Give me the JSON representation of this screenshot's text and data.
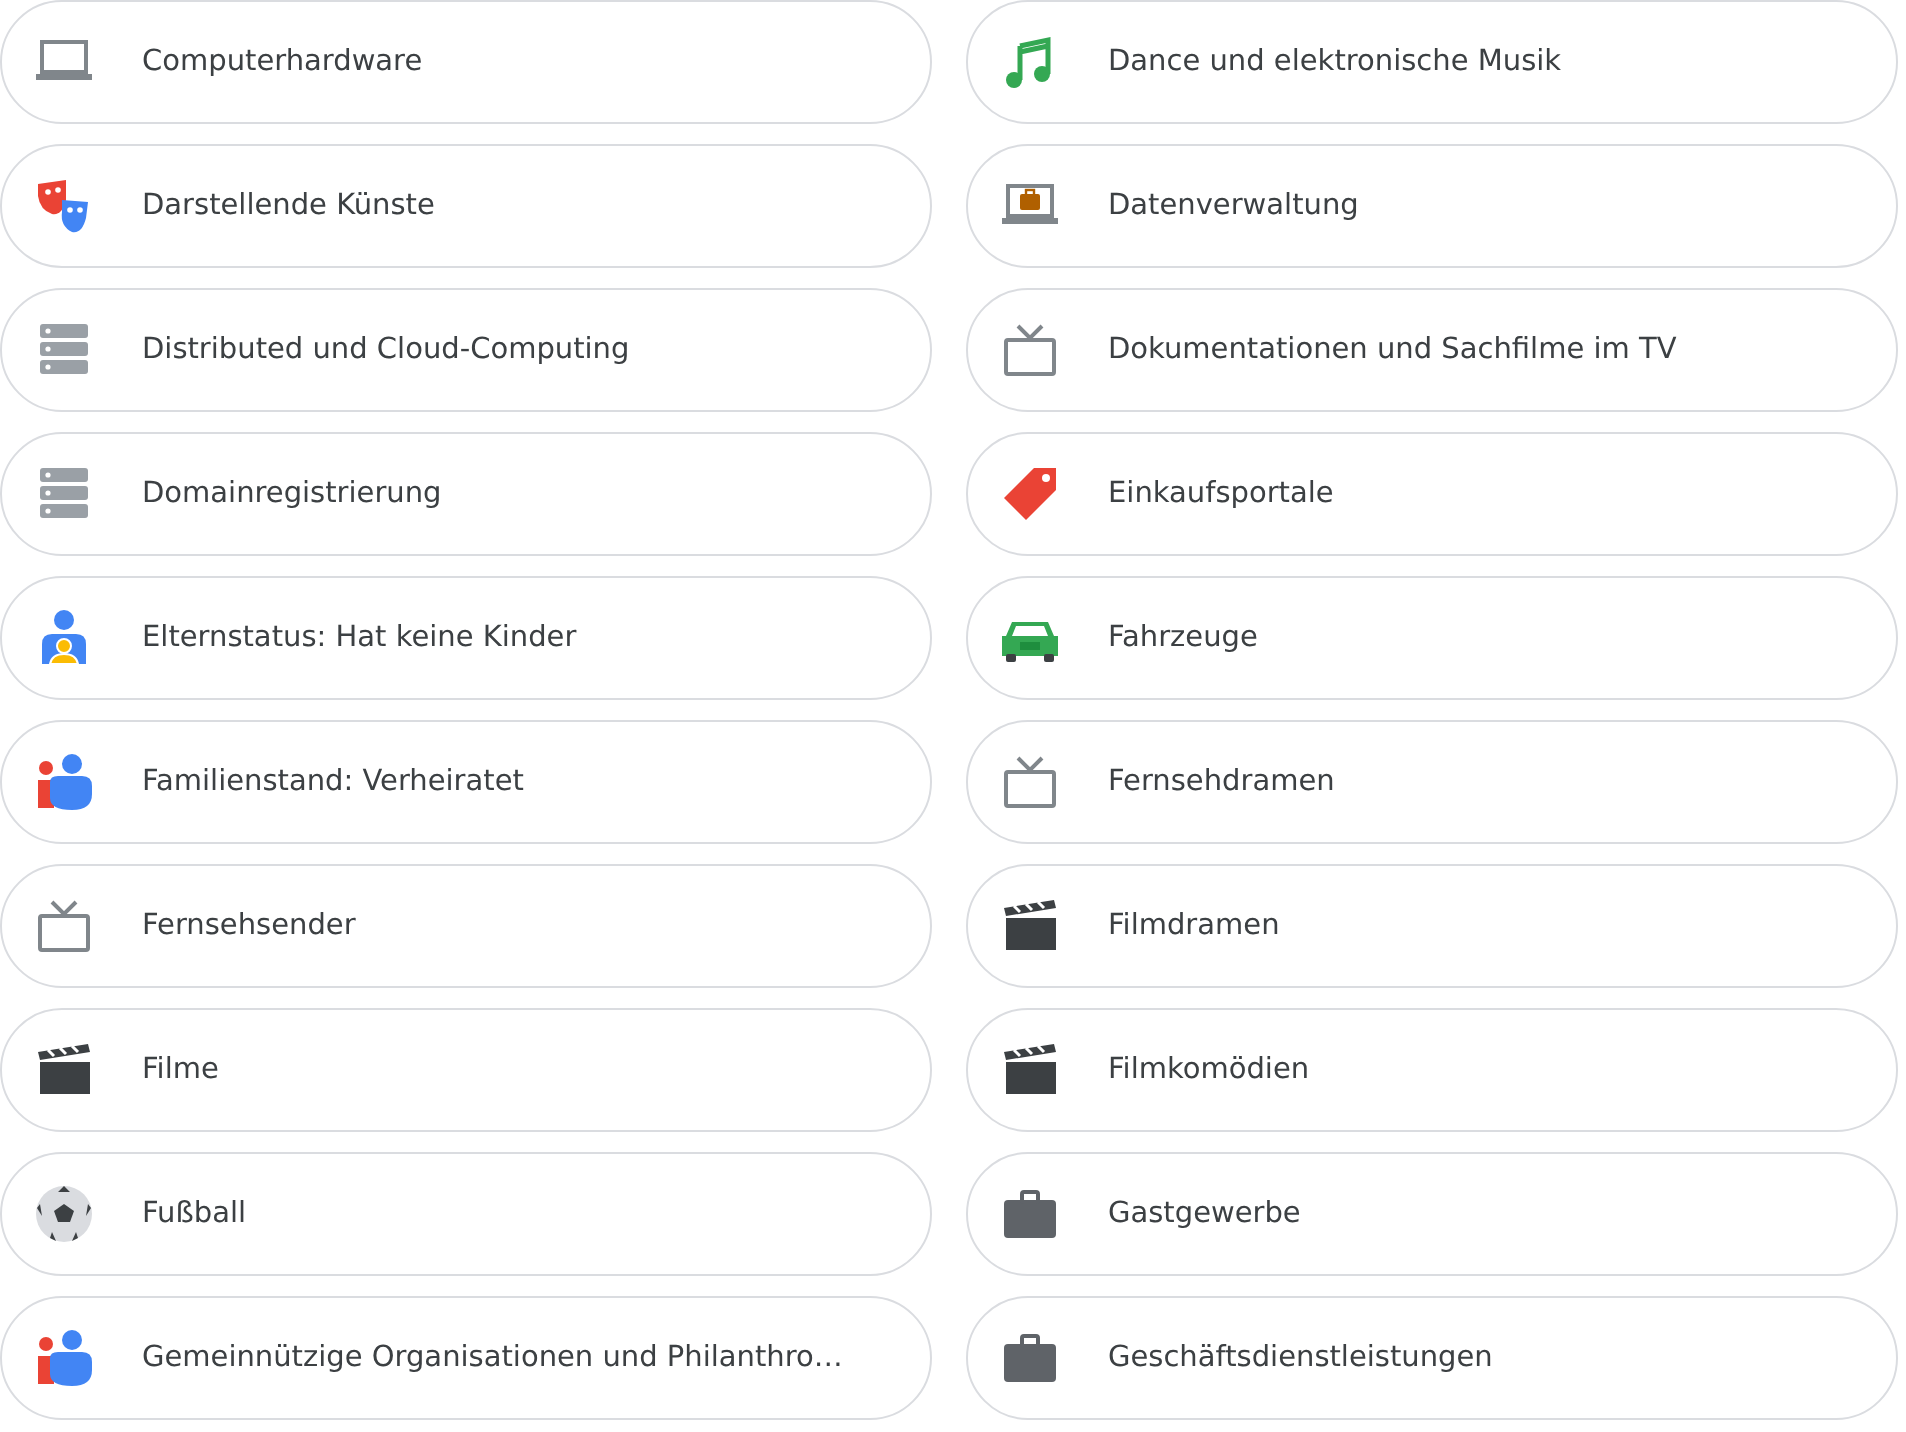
{
  "interests": [
    {
      "label": "Computerhardware",
      "kind": "laptop"
    },
    {
      "label": "Dance und elektronische Musik",
      "kind": "music"
    },
    {
      "label": "Darstellende Künste",
      "kind": "masks"
    },
    {
      "label": "Datenverwaltung",
      "kind": "laptop-case"
    },
    {
      "label": "Distributed und Cloud-Computing",
      "kind": "server"
    },
    {
      "label": "Dokumentationen und Sachfilme im TV",
      "kind": "tv"
    },
    {
      "label": "Domainregistrierung",
      "kind": "server"
    },
    {
      "label": "Einkaufsportale",
      "kind": "tag"
    },
    {
      "label": "Elternstatus: Hat keine Kinder",
      "kind": "parent"
    },
    {
      "label": "Fahrzeuge",
      "kind": "car"
    },
    {
      "label": "Familienstand: Verheiratet",
      "kind": "couple"
    },
    {
      "label": "Fernsehdramen",
      "kind": "tv"
    },
    {
      "label": "Fernsehsender",
      "kind": "tv"
    },
    {
      "label": "Filmdramen",
      "kind": "clapper"
    },
    {
      "label": "Filme",
      "kind": "clapper"
    },
    {
      "label": "Filmkomödien",
      "kind": "clapper"
    },
    {
      "label": "Fußball",
      "kind": "ball"
    },
    {
      "label": "Gastgewerbe",
      "kind": "briefcase"
    },
    {
      "label": "Gemeinnützige Organisationen und Philanthro…",
      "kind": "couple"
    },
    {
      "label": "Geschäftsdienstleistungen",
      "kind": "briefcase"
    }
  ]
}
